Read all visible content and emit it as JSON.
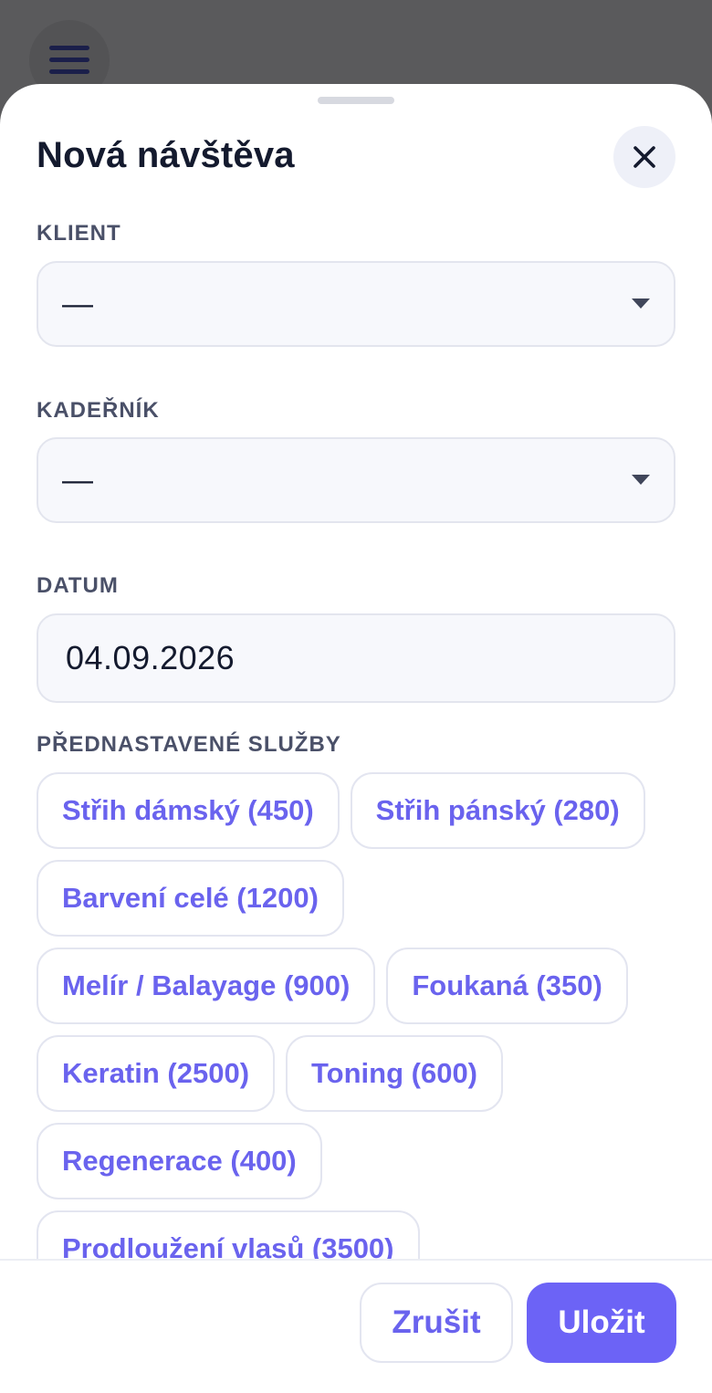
{
  "header": {
    "title": "Nová návštěva"
  },
  "form": {
    "client": {
      "label": "KLIENT",
      "value": "—"
    },
    "hairdresser": {
      "label": "KADEŘNÍK",
      "value": "—"
    },
    "date": {
      "label": "DATUM",
      "value": "04.09.2026"
    },
    "services": {
      "label": "PŘEDNASTAVENÉ SLUŽBY",
      "items": [
        "Střih dámský (450)",
        "Střih pánský (280)",
        "Barvení celé (1200)",
        "Melír / Balayage (900)",
        "Foukaná (350)",
        "Keratin (2500)",
        "Toning (600)",
        "Regenerace (400)",
        "Prodloužení vlasů (3500)"
      ]
    }
  },
  "footer": {
    "cancel_label": "Zrušit",
    "save_label": "Uložit"
  },
  "icons": {
    "menu": "hamburger-icon",
    "close": "close-icon",
    "dropdown": "caret-down-icon"
  },
  "colors": {
    "accent": "#6c63f6",
    "accent_text": "#6a63ee",
    "title": "#141a2e",
    "label": "#4a5068",
    "backdrop": "#5a5a5c"
  }
}
